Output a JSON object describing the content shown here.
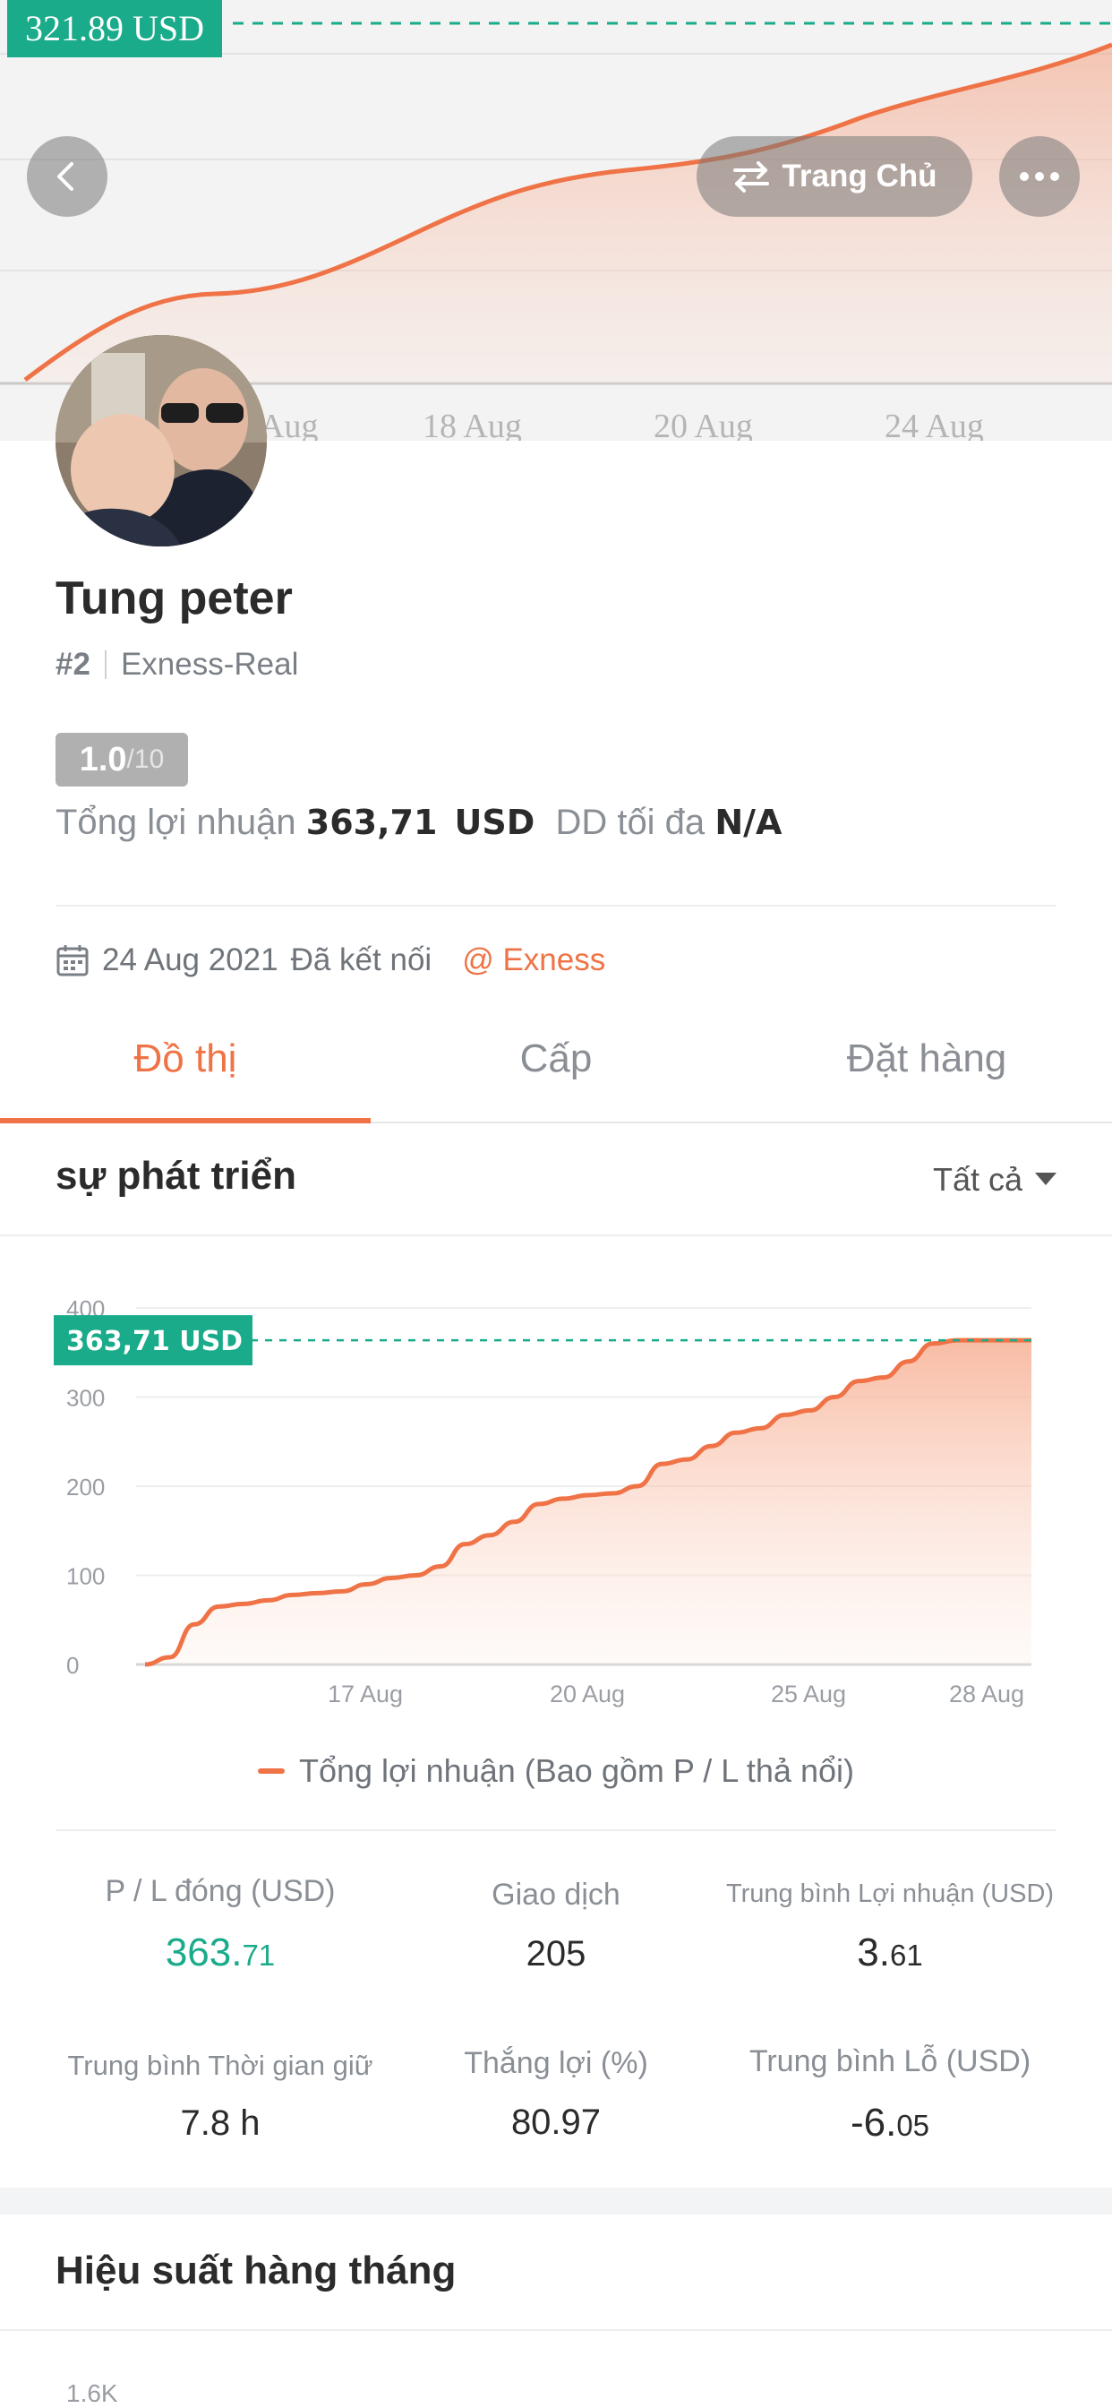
{
  "hero": {
    "price_label": "321.89 USD",
    "x_ticks": [
      "Aug",
      "18 Aug",
      "20 Aug",
      "24 Aug"
    ],
    "nav_button_label": "Trang Chủ",
    "back_icon": "chevron-left-icon",
    "swap_icon": "swap-arrows-icon",
    "more_icon": "more-dots-icon"
  },
  "profile": {
    "name": "Tung peter",
    "rank": "#2",
    "account_type": "Exness-Real",
    "score_value": "1.0",
    "score_max": "/10",
    "total_profit_label": "Tổng lợi nhuận",
    "total_profit_value": "363,71",
    "total_profit_unit": "USD",
    "max_dd_label": "DD tối đa",
    "max_dd_value": "N/A",
    "connected_date": "24 Aug 2021",
    "connected_label": "Đã kết nối",
    "broker": "@ Exness"
  },
  "tabs": [
    "Đồ thị",
    "Cấp",
    "Đặt hàng"
  ],
  "growth": {
    "title": "sự phát triển",
    "filter_label": "Tất cả"
  },
  "chart_data": {
    "type": "area",
    "y_ticks": [
      "0",
      "100",
      "200",
      "300",
      "400"
    ],
    "x_ticks": [
      "17 Aug",
      "20 Aug",
      "25 Aug",
      "28 Aug"
    ],
    "ylim": [
      0,
      400
    ],
    "current_label": "363,71  USD",
    "current_value": 363.71,
    "legend": "Tổng lợi nhuận (Bao gồm P / L thả nổi)",
    "series": [
      {
        "name": "Tổng lợi nhuận (Bao gồm P / L thả nổi)",
        "color": "#ef7346",
        "values": [
          0,
          8,
          45,
          65,
          68,
          72,
          78,
          80,
          82,
          90,
          97,
          100,
          110,
          135,
          145,
          160,
          180,
          186,
          190,
          192,
          200,
          225,
          230,
          245,
          260,
          265,
          280,
          285,
          300,
          318,
          322,
          340,
          360,
          363.71,
          363.71,
          363.71,
          363.71
        ]
      }
    ]
  },
  "stats": {
    "closed_pl": {
      "label": "P / L đóng (USD)",
      "whole": "363.",
      "frac": "71",
      "color": "#1aab8a"
    },
    "trades": {
      "label": "Giao dịch",
      "value": "205"
    },
    "avg_profit": {
      "label": "Trung bình Lợi nhuận (USD)",
      "whole": "3.",
      "frac": "61"
    },
    "avg_hold": {
      "label": "Trung bình Thời gian giữ",
      "value": "7.8 h"
    },
    "win_rate": {
      "label": "Thắng lợi (%)",
      "value": "80.97"
    },
    "avg_loss": {
      "label": "Trung bình Lỗ (USD)",
      "whole": "-6.",
      "frac": "05"
    }
  },
  "monthly": {
    "title": "Hiệu suất hàng tháng",
    "y_tick_top": "1.6K"
  }
}
